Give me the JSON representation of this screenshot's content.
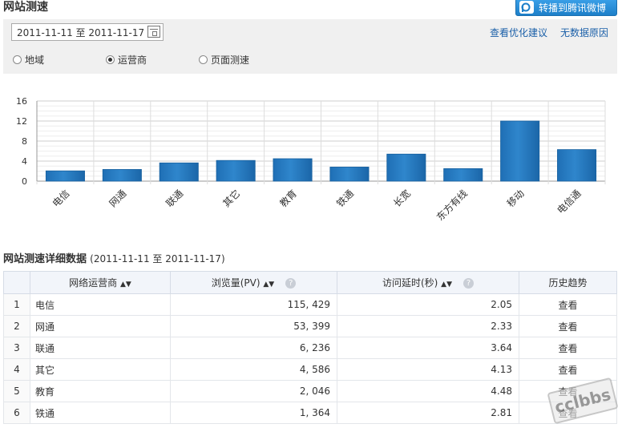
{
  "header": {
    "title": "网站测速",
    "share_label": "转播到腾讯微博",
    "share_icon": "weibo-icon"
  },
  "toolbar": {
    "date_range": "2011-11-11 至 2011-11-17",
    "link_optimize": "查看优化建议",
    "link_nodata": "无数据原因",
    "radios": [
      {
        "label": "地域",
        "checked": false
      },
      {
        "label": "运营商",
        "checked": true
      },
      {
        "label": "页面测速",
        "checked": false
      }
    ]
  },
  "chart_data": {
    "type": "bar",
    "categories": [
      "电信",
      "网通",
      "联通",
      "其它",
      "教育",
      "铁通",
      "长宽",
      "东方有线",
      "移动",
      "电信通"
    ],
    "values": [
      2.05,
      2.33,
      3.64,
      4.13,
      4.48,
      2.81,
      5.4,
      2.5,
      12.0,
      6.3
    ],
    "yticks": [
      0,
      4,
      8,
      12,
      16
    ],
    "ylim": [
      0,
      16
    ],
    "grid": true,
    "bar_color": "#2f86cc"
  },
  "section": {
    "title": "网站测速详细数据",
    "range": "(2011-11-11 至 2011-11-17)"
  },
  "table": {
    "headers": {
      "operator": "网络运营商",
      "pv": "浏览量(PV)",
      "delay": "访问延时(秒)",
      "trend": "历史趋势"
    },
    "rows": [
      {
        "idx": "1",
        "name": "电信",
        "pv": "115, 429",
        "delay": "2.05",
        "trend": "查看"
      },
      {
        "idx": "2",
        "name": "网通",
        "pv": "53, 399",
        "delay": "2.33",
        "trend": "查看"
      },
      {
        "idx": "3",
        "name": "联通",
        "pv": "6, 236",
        "delay": "3.64",
        "trend": "查看"
      },
      {
        "idx": "4",
        "name": "其它",
        "pv": "4, 586",
        "delay": "4.13",
        "trend": "查看"
      },
      {
        "idx": "5",
        "name": "教育",
        "pv": "2, 046",
        "delay": "4.48",
        "trend": "查看"
      },
      {
        "idx": "6",
        "name": "铁通",
        "pv": "1, 364",
        "delay": "2.81",
        "trend": "查看"
      }
    ]
  },
  "watermark": "cclbbs"
}
